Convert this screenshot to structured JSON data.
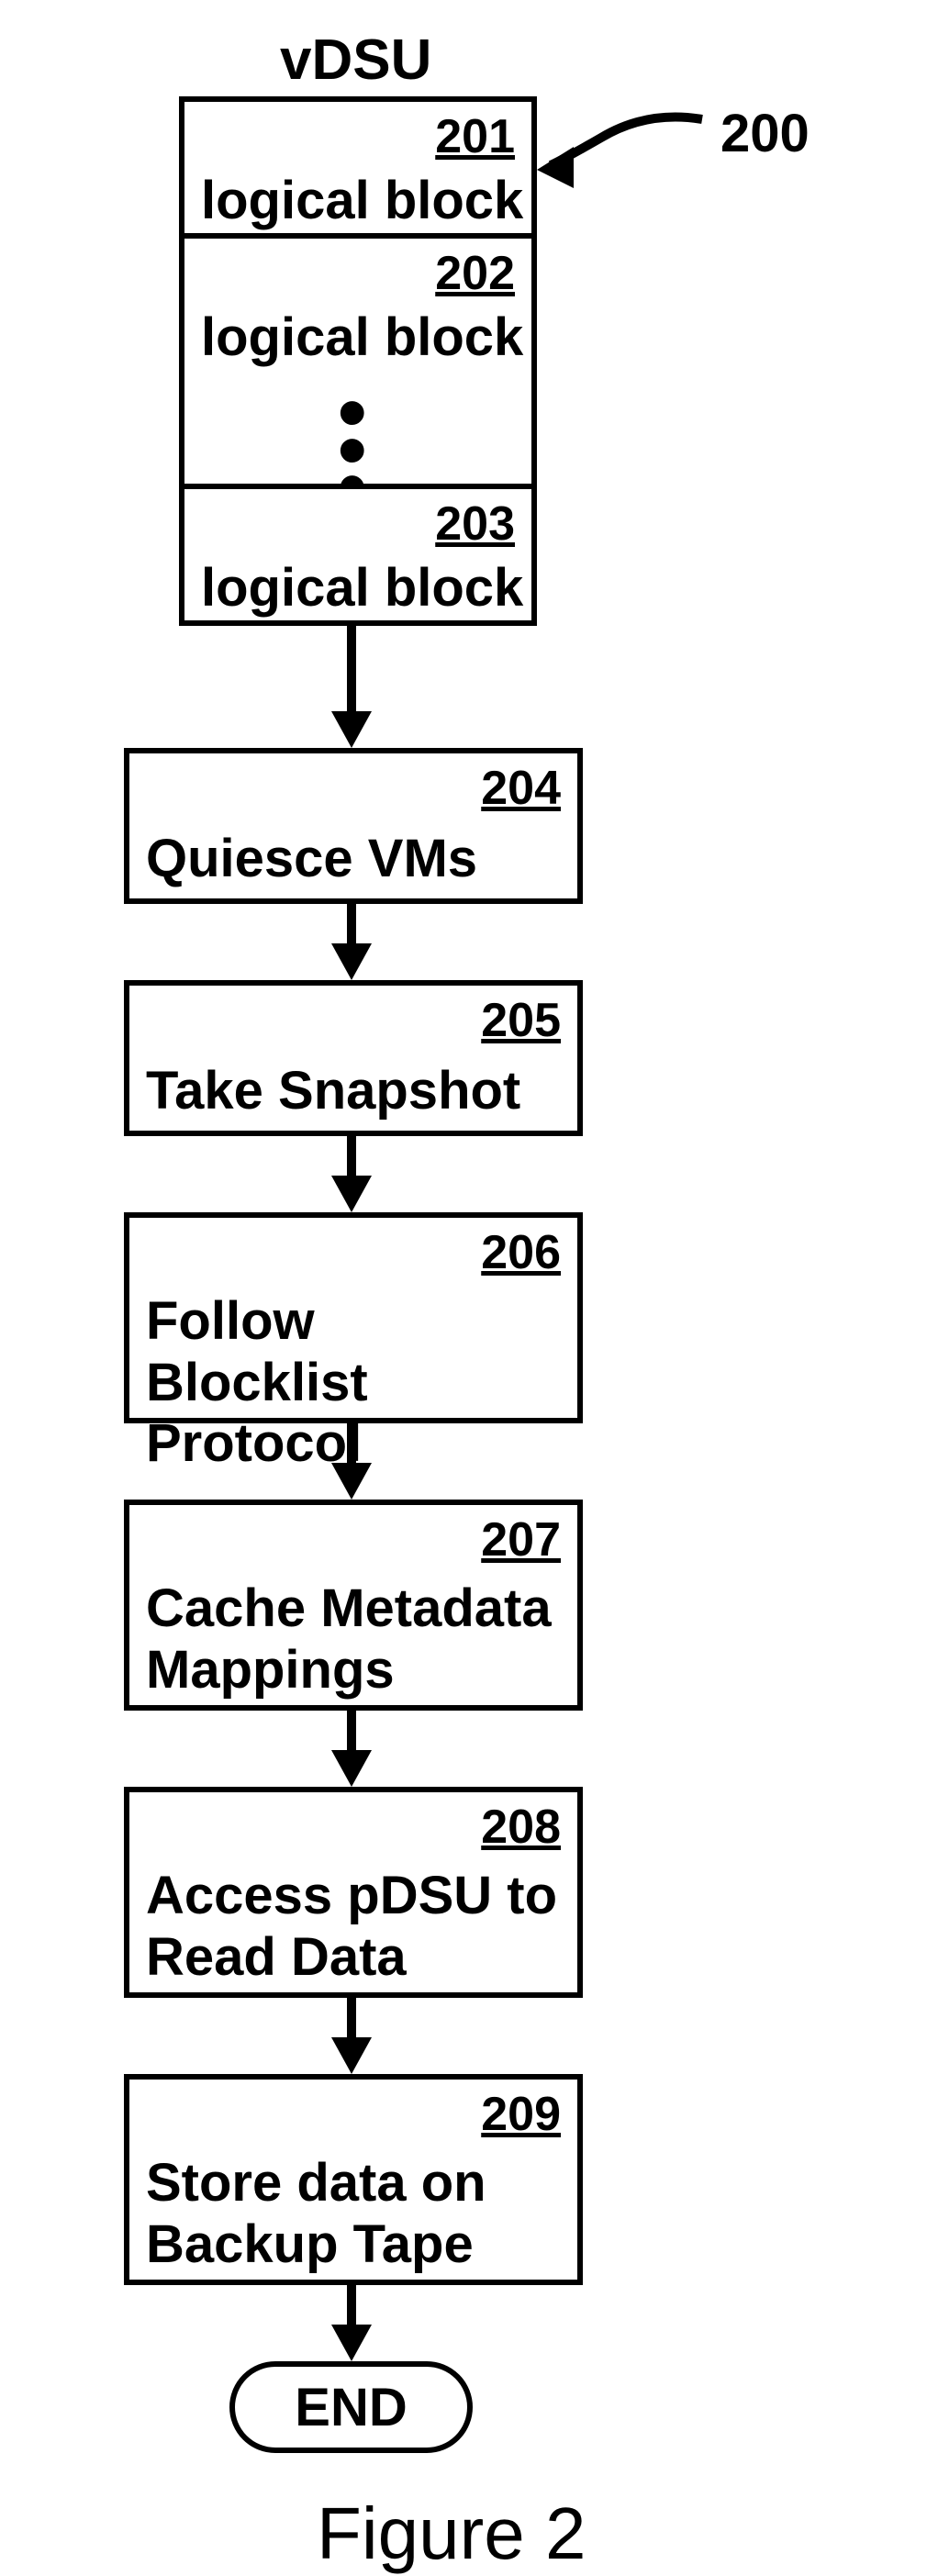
{
  "title": "vDSU",
  "pointer_label": "200",
  "vdsu": {
    "block1": {
      "num": "201",
      "label": "logical block"
    },
    "block2": {
      "num": "202",
      "label": "logical block"
    },
    "block3": {
      "num": "203",
      "label": "logical block"
    }
  },
  "steps": {
    "s204": {
      "num": "204",
      "label": "Quiesce VMs"
    },
    "s205": {
      "num": "205",
      "label": "Take Snapshot"
    },
    "s206": {
      "num": "206",
      "label": "Follow\nBlocklist Protocol"
    },
    "s207": {
      "num": "207",
      "label": "Cache Metadata\nMappings"
    },
    "s208": {
      "num": "208",
      "label": "Access pDSU to\nRead Data"
    },
    "s209": {
      "num": "209",
      "label": "Store data on\nBackup Tape"
    }
  },
  "end_label": "END",
  "figure_caption": "Figure 2"
}
